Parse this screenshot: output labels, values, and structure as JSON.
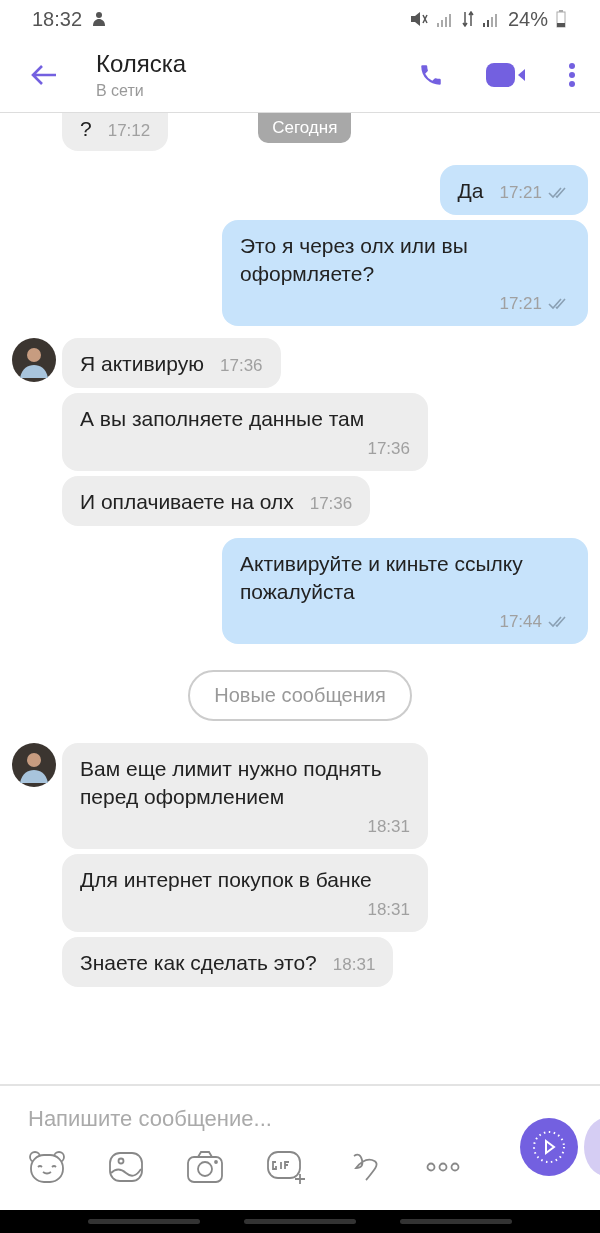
{
  "status_bar": {
    "time": "18:32",
    "battery": "24%"
  },
  "header": {
    "title": "Коляска",
    "subtitle": "В сети"
  },
  "top_row": {
    "text": "?",
    "time": "17:12",
    "date_pill": "Сегодня"
  },
  "messages": [
    {
      "kind": "outgoing",
      "text": "Да",
      "time": "17:21",
      "read": true
    },
    {
      "kind": "outgoing",
      "text": "Это я через олх или вы оформляете?",
      "time": "17:21",
      "read": true
    },
    {
      "kind": "incoming",
      "text": "Я активирую",
      "time": "17:36",
      "show_avatar": true
    },
    {
      "kind": "incoming",
      "text": "А вы заполняете данные там",
      "time": "17:36",
      "show_avatar": false
    },
    {
      "kind": "incoming",
      "text": "И оплачиваете на олх",
      "time": "17:36",
      "show_avatar": false
    },
    {
      "kind": "outgoing",
      "text": "Активируйте и киньте ссылку пожалуйста",
      "time": "17:44",
      "read": true
    },
    {
      "kind": "divider",
      "text": "Новые сообщения"
    },
    {
      "kind": "incoming",
      "text": "Вам еще лимит нужно поднять перед оформлением",
      "time": "18:31",
      "show_avatar": true
    },
    {
      "kind": "incoming",
      "text": "Для интернет покупок в банке",
      "time": "18:31",
      "show_avatar": false
    },
    {
      "kind": "incoming",
      "text": "Знаете как сделать это?",
      "time": "18:31",
      "show_avatar": false
    }
  ],
  "composer": {
    "placeholder": "Напишите сообщение..."
  }
}
